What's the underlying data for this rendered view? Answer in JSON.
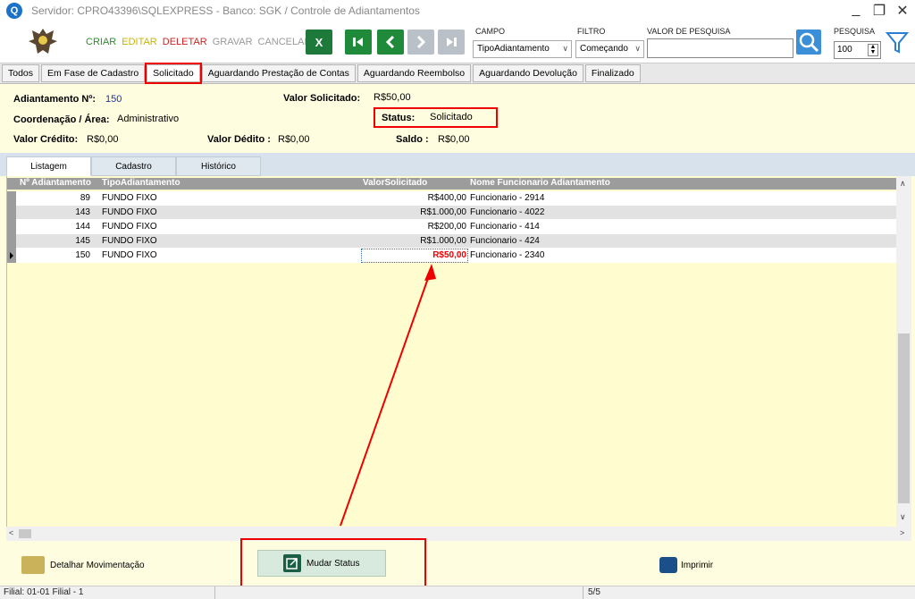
{
  "window": {
    "title": "Servidor: CPRO43396\\SQLEXPRESS - Banco: SGK / Controle de Adiantamentos",
    "logo_letter": "Q",
    "minimize": "_",
    "restore": "❐",
    "close": "✕"
  },
  "toolbar": {
    "actions": {
      "criar": "CRIAR",
      "editar": "EDITAR",
      "deletar": "DELETAR",
      "gravar": "GRAVAR",
      "cancelar": "CANCELAR"
    },
    "excel_label": "X",
    "campo_label": "CAMPO",
    "campo_value": "TipoAdiantamento",
    "filtro_label": "FILTRO",
    "filtro_value": "Começando",
    "valor_label": "VALOR DE PESQUISA",
    "valor_value": "",
    "pesquisa_label": "PESQUISA",
    "pesquisa_value": "100"
  },
  "status_tabs": [
    {
      "label": "Todos"
    },
    {
      "label": "Em Fase de Cadastro"
    },
    {
      "label": "Solicitado",
      "active": true
    },
    {
      "label": "Aguardando Prestação de Contas"
    },
    {
      "label": "Aguardando Reembolso"
    },
    {
      "label": "Aguardando Devolução"
    },
    {
      "label": "Finalizado"
    }
  ],
  "info": {
    "adiantamento_label": "Adiantamento Nº:",
    "adiantamento_value": "150",
    "valor_solicitado_label": "Valor Solicitado:",
    "valor_solicitado_value": "R$50,00",
    "coordenacao_label": "Coordenação / Área:",
    "coordenacao_value": "Administrativo",
    "status_label": "Status:",
    "status_value": "Solicitado",
    "valor_credito_label": "Valor Crédito:",
    "valor_credito_value": "R$0,00",
    "valor_debito_label": "Valor Dédito :",
    "valor_debito_value": "R$0,00",
    "saldo_label": "Saldo :",
    "saldo_value": "R$0,00"
  },
  "sub_tabs": [
    {
      "label": "Listagem",
      "active": true
    },
    {
      "label": "Cadastro"
    },
    {
      "label": "Histórico"
    }
  ],
  "grid": {
    "columns": [
      "Nº Adiantamento",
      "TipoAdiantamento",
      "ValorSolicitado",
      "Nome Funcionario Adiantamento"
    ],
    "rows": [
      {
        "num": "89",
        "tipo": "FUNDO FIXO",
        "valor": "R$400,00",
        "nome": "Funcionario - 2914"
      },
      {
        "num": "143",
        "tipo": "FUNDO FIXO",
        "valor": "R$1.000,00",
        "nome": "Funcionario - 4022"
      },
      {
        "num": "144",
        "tipo": "FUNDO FIXO",
        "valor": "R$200,00",
        "nome": "Funcionario - 414"
      },
      {
        "num": "145",
        "tipo": "FUNDO FIXO",
        "valor": "R$1.000,00",
        "nome": "Funcionario - 424"
      },
      {
        "num": "150",
        "tipo": "FUNDO FIXO",
        "valor": "R$50,00",
        "nome": "Funcionario - 2340",
        "selected": true
      }
    ]
  },
  "bottom": {
    "detalhar": "Detalhar Movimentação",
    "mudar_status": "Mudar Status",
    "imprimir": "Imprimir"
  },
  "statusbar": {
    "filial": "Filial: 01-01 Filial - 1",
    "record": "5/5"
  },
  "colors": {
    "annotation_red": "#e00000",
    "accent_green": "#1e8a3a",
    "accent_blue": "#3a8fd8"
  }
}
